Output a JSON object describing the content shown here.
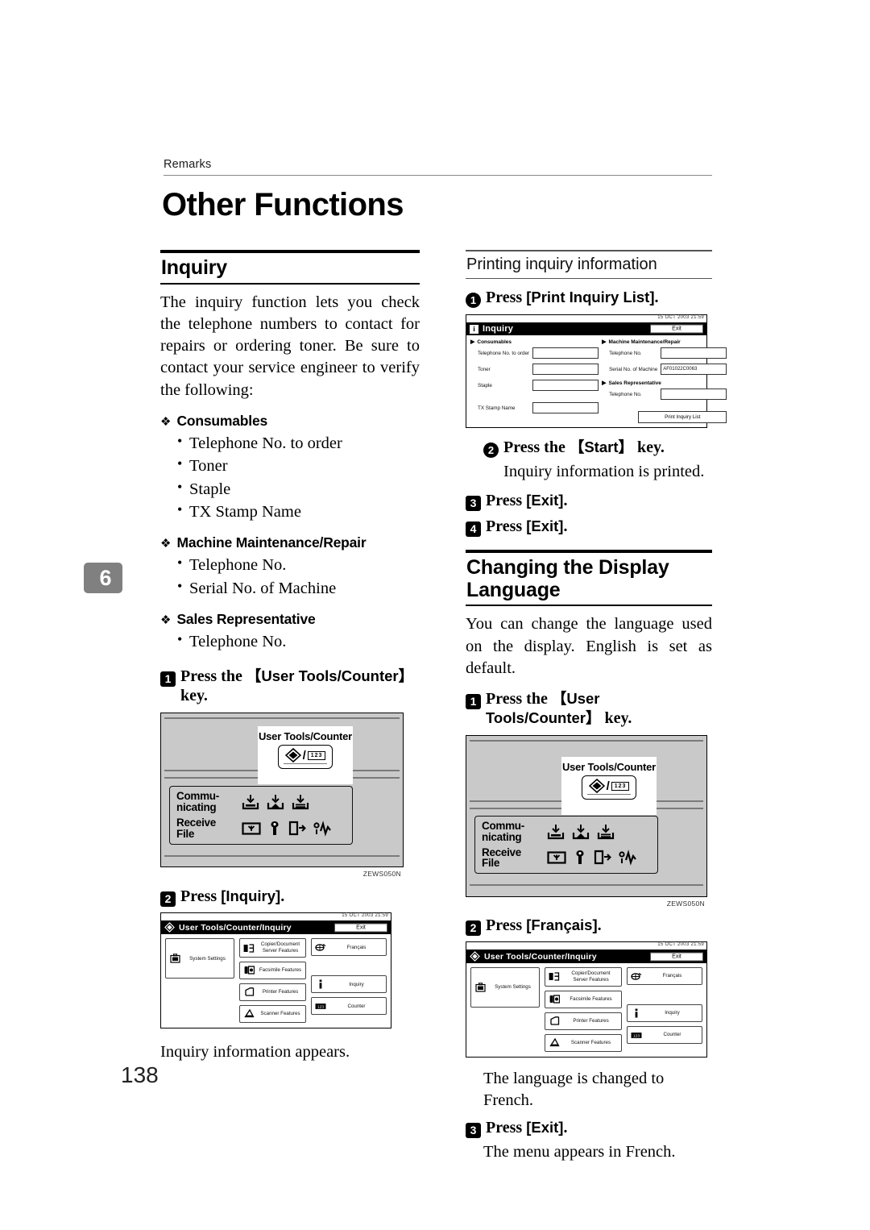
{
  "header": {
    "running_head": "Remarks",
    "page_title": "Other Functions",
    "chapter_tab": "6",
    "folio": "138"
  },
  "left_column": {
    "section_title": "Inquiry",
    "intro": "The inquiry function lets you check the telephone numbers to contact for repairs or ordering toner. Be sure to contact your service engineer to verify the following:",
    "groups": [
      {
        "label": "Consumables",
        "items": [
          "Telephone No. to order",
          "Toner",
          "Staple",
          "TX Stamp Name"
        ]
      },
      {
        "label": "Machine Maintenance/Repair",
        "items": [
          "Telephone No.",
          "Serial No. of Machine"
        ]
      },
      {
        "label": "Sales Representative",
        "items": [
          "Telephone No."
        ]
      }
    ],
    "step1": {
      "badge": "1",
      "text_pre": "Press the",
      "ui": "【User Tools/Counter】",
      "text_post": "key."
    },
    "figure1_caption": "ZEWS050N",
    "step2": {
      "badge": "2",
      "text_pre": "Press",
      "ui": "[Inquiry]",
      "text_post": "."
    },
    "step2_result": "Inquiry information appears."
  },
  "right_column": {
    "subsection_title": "Printing inquiry information",
    "step1": {
      "badge": "1",
      "text_pre": "Press",
      "ui": "[Print Inquiry List]",
      "text_post": "."
    },
    "step2": {
      "badge": "2",
      "text_pre": "Press the",
      "ui": "【Start】",
      "text_post": "key."
    },
    "step2_result": "Inquiry information is printed.",
    "step3": {
      "badge": "3",
      "text_pre": "Press",
      "ui": "[Exit]",
      "text_post": "."
    },
    "step4": {
      "badge": "4",
      "text_pre": "Press",
      "ui": "[Exit]",
      "text_post": "."
    },
    "section_title": "Changing the Display Language",
    "intro": "You can change the language used on the display. English is set as default.",
    "lang_step1": {
      "badge": "1",
      "text_pre": "Press the",
      "ui": "【User Tools/Counter】",
      "text_post": "key."
    },
    "figure_caption": "ZEWS050N",
    "lang_step2": {
      "badge": "2",
      "text_pre": "Press",
      "ui": "[Français]",
      "text_post": "."
    },
    "lang_step2_result": "The language is changed to French.",
    "lang_step3": {
      "badge": "3",
      "text_pre": "Press",
      "ui": "[Exit]",
      "text_post": "."
    },
    "lang_step3_result": "The menu appears in French."
  },
  "inquiry_screen": {
    "clock": "15  OCT   2003 21:59",
    "title": "Inquiry",
    "exit_label": "Exit",
    "left_group_label": "Consumables",
    "left_fields": [
      {
        "label": "Telephone No. to order",
        "value": ""
      },
      {
        "label": "Toner",
        "value": ""
      },
      {
        "label": "Staple",
        "value": ""
      },
      {
        "label": "TX Stamp Name",
        "value": ""
      }
    ],
    "right_group_label": "Machine Maintenance/Repair",
    "right_fields": [
      {
        "label": "Telephone No.",
        "value": ""
      },
      {
        "label": "Serial No. of Machine",
        "value": "AF01022C0063"
      }
    ],
    "sales_group_label": "Sales Representative",
    "sales_fields": [
      {
        "label": "Telephone No.",
        "value": ""
      }
    ],
    "print_button": "Print Inquiry List"
  },
  "user_tools_screen": {
    "clock": "15  OCT   2003 21:59",
    "title": "User Tools/Counter/Inquiry",
    "exit_label": "Exit",
    "tiles_col1": [
      {
        "label": "System Settings",
        "icon": "system-settings-icon"
      }
    ],
    "tiles_col2": [
      {
        "label": "Copier/Document Server\nFeatures",
        "icon": "copier-icon"
      },
      {
        "label": "Facsimile Features",
        "icon": "fax-icon"
      },
      {
        "label": "Printer Features",
        "icon": "printer-icon"
      },
      {
        "label": "Scanner Features",
        "icon": "scanner-icon"
      }
    ],
    "tiles_col3": [
      {
        "label": "Français",
        "icon": "language-icon"
      },
      {
        "label": "Inquiry",
        "icon": "info-icon"
      },
      {
        "label": "Counter",
        "icon": "counter-icon"
      }
    ]
  },
  "control_panel": {
    "key_label": "User Tools/Counter",
    "key_glyph": "123",
    "status_line1": "Commu-\nnicating",
    "status_line2": "Receive\nFile",
    "caption": "ZEWS050N"
  }
}
